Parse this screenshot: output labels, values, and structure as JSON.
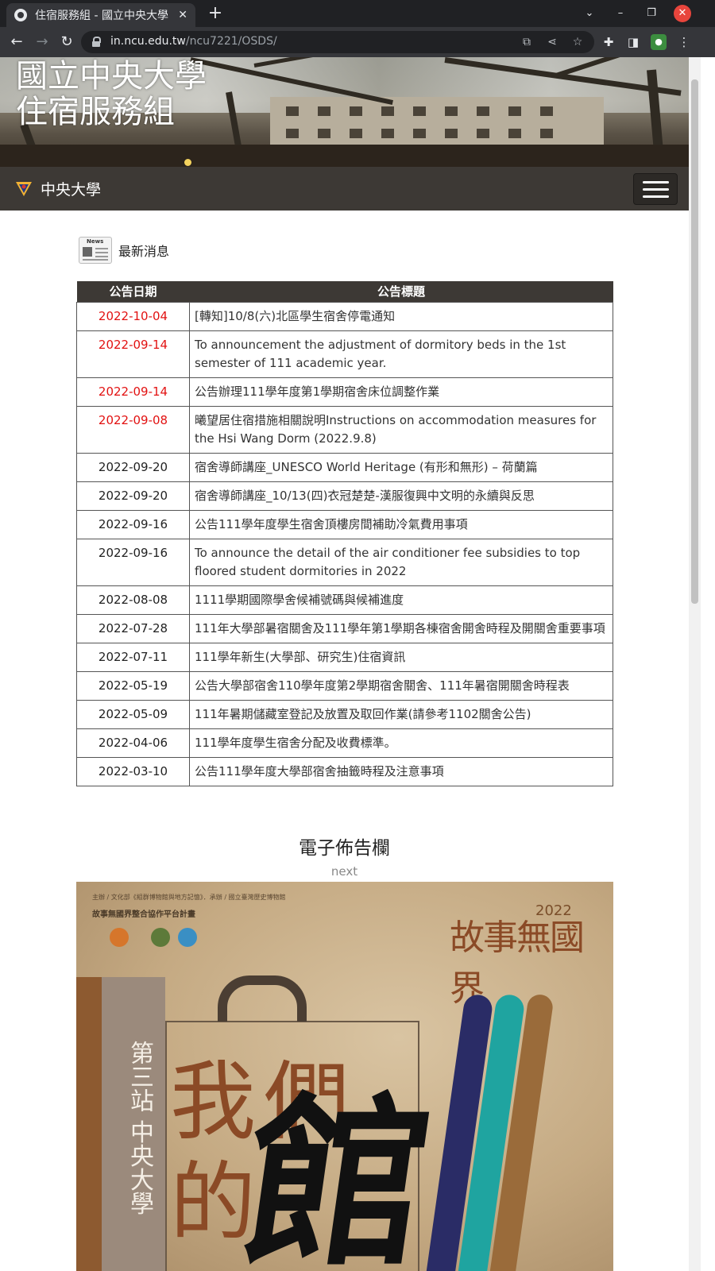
{
  "browser": {
    "tab_title": "住宿服務組 - 國立中央大學",
    "url_host": "in.ncu.edu.tw",
    "url_path": "/ncu7221/OSDS/"
  },
  "site": {
    "banner_line1": "國立中央大學",
    "banner_line2": "住宿服務組",
    "brand_name": "中央大學"
  },
  "news": {
    "section_label": "最新消息",
    "icon_tag": "News",
    "col_date": "公告日期",
    "col_title": "公告標題",
    "rows": [
      {
        "date": "2022-10-04",
        "title": "[轉知]10/8(六)北區學生宿舍停電通知",
        "highlight": true
      },
      {
        "date": "2022-09-14",
        "title": "To announcement the adjustment of dormitory beds in the 1st semester of 111 academic year.",
        "highlight": true
      },
      {
        "date": "2022-09-14",
        "title": "公告辦理111學年度第1學期宿舍床位調整作業",
        "highlight": true
      },
      {
        "date": "2022-09-08",
        "title": "曦望居住宿措施相關說明Instructions on accommodation measures for the Hsi Wang Dorm (2022.9.8)",
        "highlight": true
      },
      {
        "date": "2022-09-20",
        "title": "宿舍導師講座_UNESCO World Heritage (有形和無形) – 荷蘭篇",
        "highlight": false
      },
      {
        "date": "2022-09-20",
        "title": "宿舍導師講座_10/13(四)衣冠楚楚-漢服復興中文明的永續與反思",
        "highlight": false
      },
      {
        "date": "2022-09-16",
        "title": "公告111學年度學生宿舍頂樓房間補助冷氣費用事項",
        "highlight": false
      },
      {
        "date": "2022-09-16",
        "title": "To announce the detail of the air conditioner fee subsidies to top floored student dormitories in 2022",
        "highlight": false
      },
      {
        "date": "2022-08-08",
        "title": "1111學期國際學舍候補號碼與候補進度",
        "highlight": false
      },
      {
        "date": "2022-07-28",
        "title": "111年大學部暑宿關舍及111學年第1學期各棟宿舍開舍時程及開關舍重要事項",
        "highlight": false
      },
      {
        "date": "2022-07-11",
        "title": "111學年新生(大學部、研究生)住宿資訊",
        "highlight": false
      },
      {
        "date": "2022-05-19",
        "title": "公告大學部宿舍110學年度第2學期宿舍關舍、111年暑宿開關舍時程表",
        "highlight": false
      },
      {
        "date": "2022-05-09",
        "title": "111年暑期儲藏室登記及放置及取回作業(請參考1102關舍公告)",
        "highlight": false
      },
      {
        "date": "2022-04-06",
        "title": "111學年度學生宿舍分配及收費標準。",
        "highlight": false
      },
      {
        "date": "2022-03-10",
        "title": "公告111學年度大學部宿舍抽籤時程及注意事項",
        "highlight": false
      }
    ]
  },
  "board": {
    "title": "電子佈告欄",
    "next_label": "next",
    "poster": {
      "top_small": "主辦 / 文化部《組群博物館與地方記憶》．承辦 / 國立臺灣歷史博物館",
      "subline": "故事無國界整合協作平台計畫",
      "year": "2022",
      "story_title": "故事無國界",
      "station": "第三站 中央大學",
      "big_a": "我",
      "big_b": "們",
      "big_c": "的",
      "big_d": "館"
    }
  },
  "colors": {
    "navbar": "#3d3935",
    "date_highlight": "#e21212",
    "poster_brown": "#8b4a26"
  }
}
